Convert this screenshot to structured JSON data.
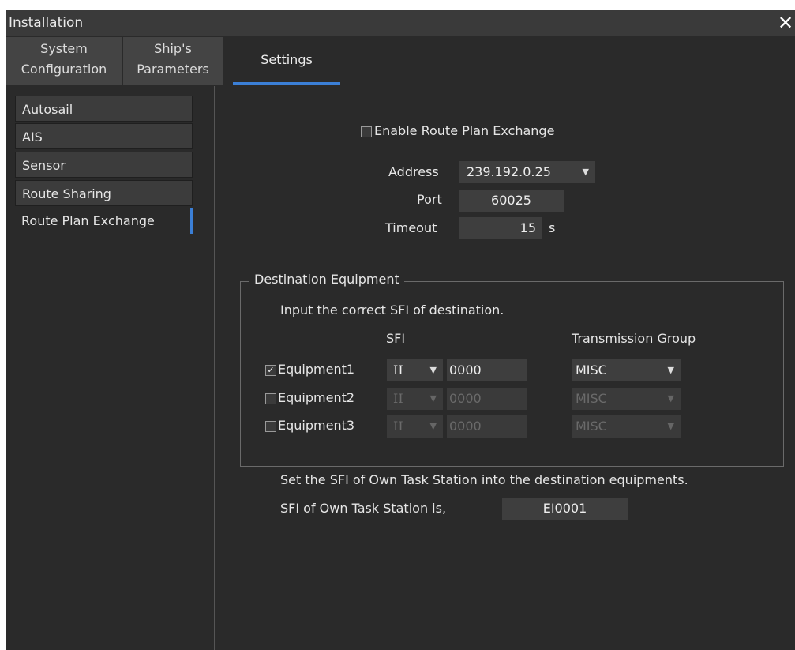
{
  "window": {
    "title": "Installation",
    "close_icon": "close-icon"
  },
  "tabs": [
    {
      "line1": "System",
      "line2": "Configuration"
    },
    {
      "line1": "Ship's",
      "line2": "Parameters"
    },
    {
      "label": "Settings"
    }
  ],
  "sidebar": {
    "items": [
      "Autosail",
      "AIS",
      "Sensor",
      "Route Sharing",
      "Route Plan Exchange"
    ]
  },
  "main": {
    "enable_label": "Enable Route Plan Exchange",
    "enable_checked": false,
    "address_label": "Address",
    "address_value": "239.192.0.25",
    "port_label": "Port",
    "port_value": "60025",
    "timeout_label": "Timeout",
    "timeout_value": "15",
    "timeout_unit": "s",
    "dest": {
      "title": "Destination Equipment",
      "instruction": "Input the correct SFI of destination.",
      "sfi_header": "SFI",
      "group_header": "Transmission Group",
      "rows": [
        {
          "label": "Equipment1",
          "checked": true,
          "prefix": "II",
          "number": "0000",
          "group": "MISC"
        },
        {
          "label": "Equipment2",
          "checked": false,
          "prefix": "II",
          "number": "0000",
          "group": "MISC"
        },
        {
          "label": "Equipment3",
          "checked": false,
          "prefix": "II",
          "number": "0000",
          "group": "MISC"
        }
      ]
    },
    "own_sfi_instruction": "Set the SFI of Own Task Station into the destination equipments.",
    "own_sfi_label": "SFI of Own Task Station is,",
    "own_sfi_value": "EI0001"
  }
}
